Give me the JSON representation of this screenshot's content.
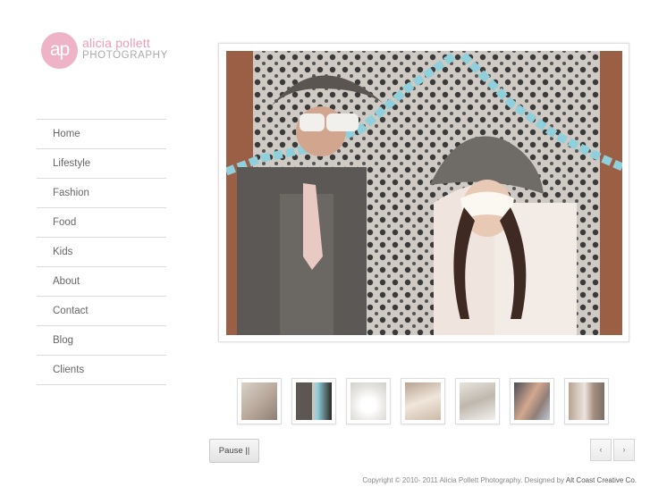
{
  "logo": {
    "initials": "ap",
    "name": "alicia pollett",
    "subtitle": "PHOTOGRAPHY",
    "brand_color": "#eeb3c7"
  },
  "nav": {
    "items": [
      {
        "label": "Home"
      },
      {
        "label": "Lifestyle"
      },
      {
        "label": "Fashion"
      },
      {
        "label": "Food"
      },
      {
        "label": "Kids"
      },
      {
        "label": "About"
      },
      {
        "label": "Contact"
      },
      {
        "label": "Blog"
      },
      {
        "label": "Clients"
      }
    ]
  },
  "slideshow": {
    "pause_label": "Pause ||",
    "prev_label": "‹",
    "next_label": "›"
  },
  "footer": {
    "copyright": "Copyright © 2010- 2011 Alicia Pollett Photography. Designed by",
    "designer": "Alt Coast Creative Co."
  }
}
